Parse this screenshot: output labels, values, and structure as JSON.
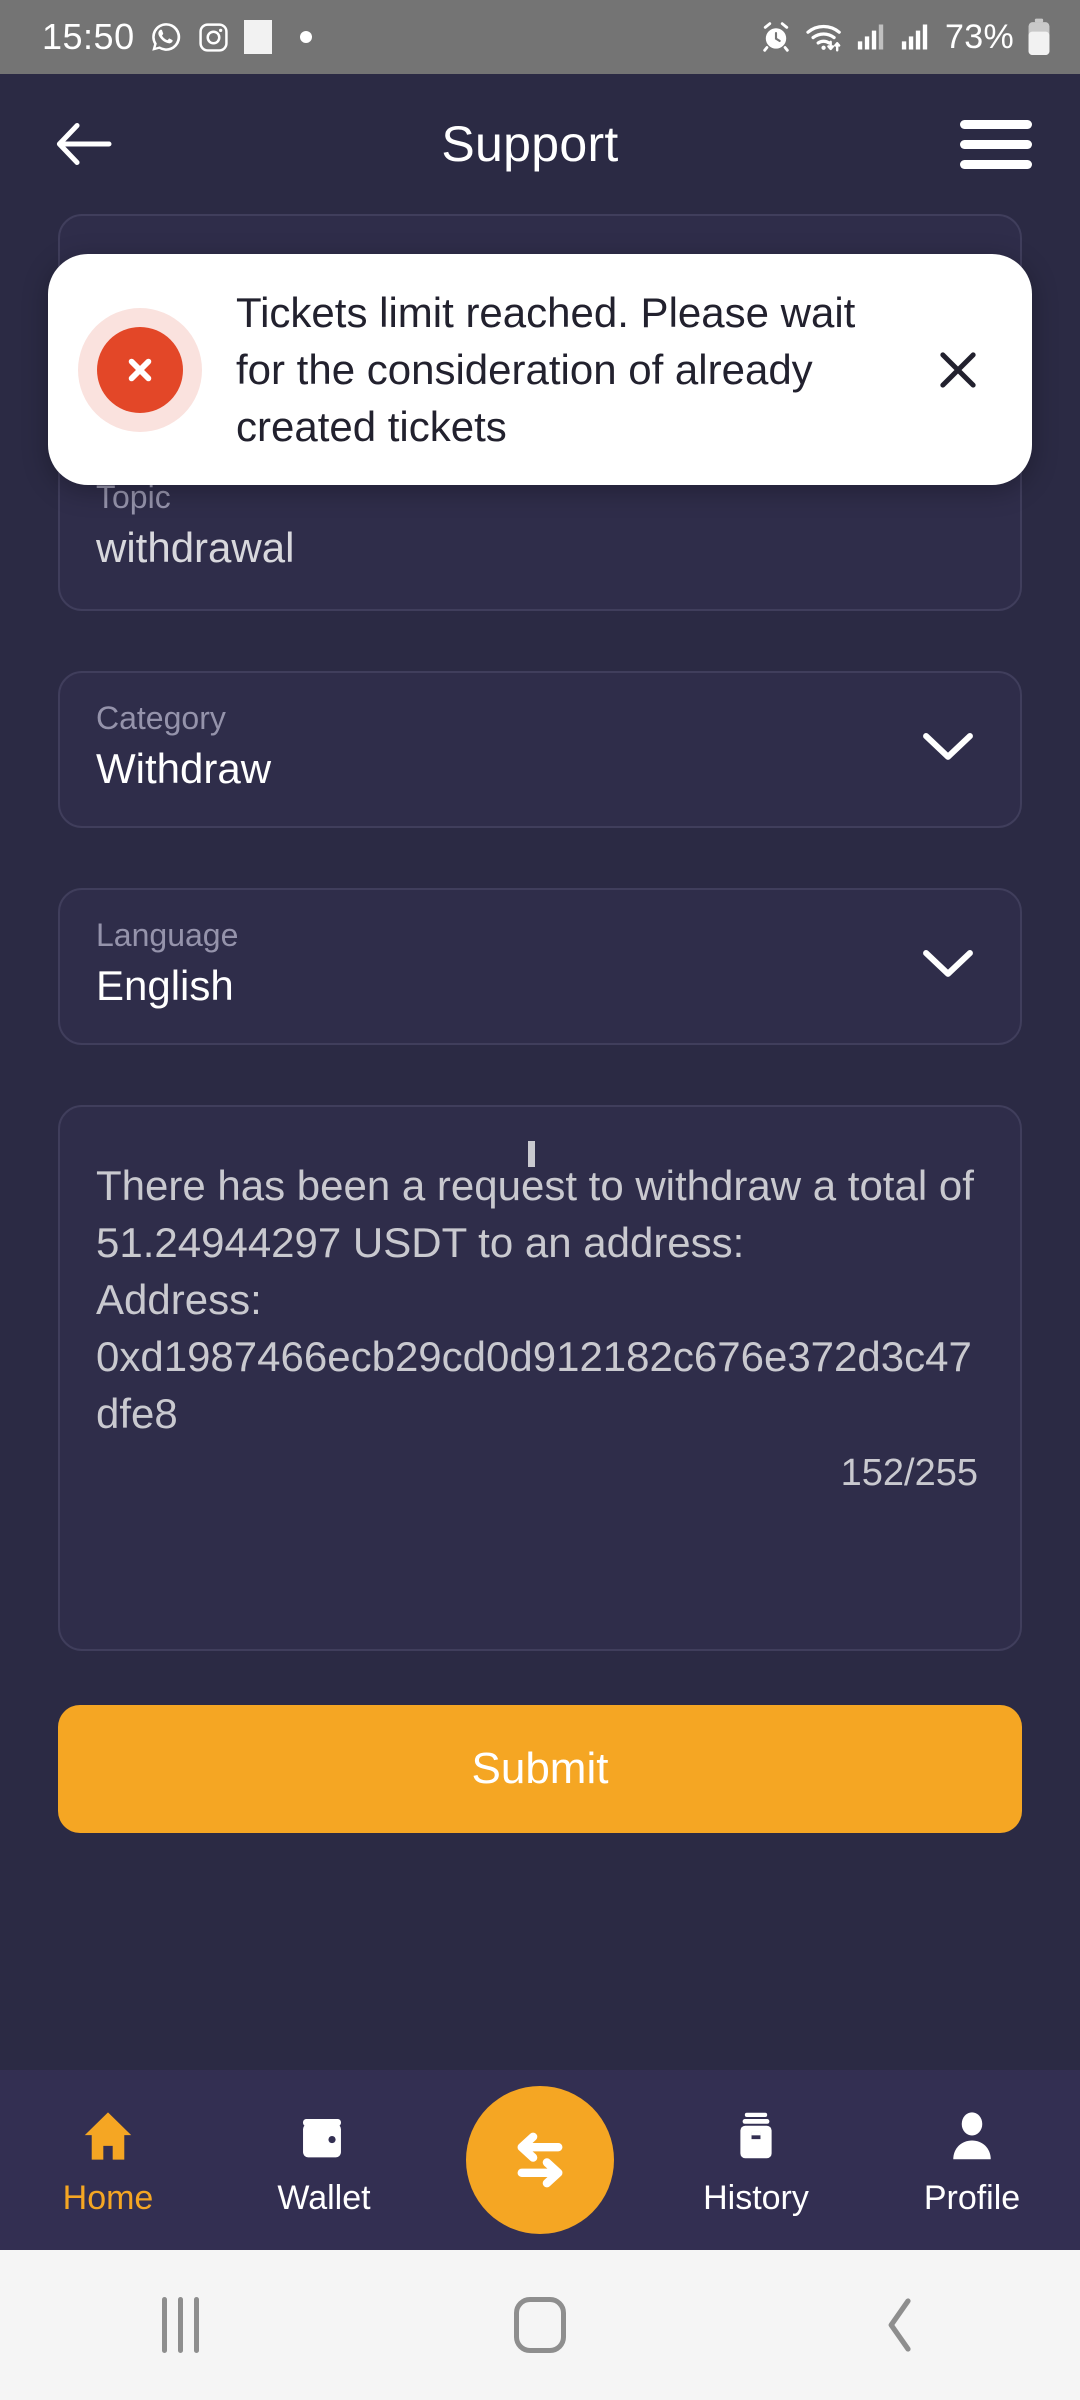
{
  "status_bar": {
    "time": "15:50",
    "icons_left": [
      "whatsapp-icon",
      "instagram-icon",
      "generic-app-icon",
      "dot-indicator-icon"
    ],
    "icons_right": [
      "alarm-icon",
      "wifi-icon",
      "signal-sim1-icon",
      "signal-sim2-icon"
    ],
    "battery_percent": "73%"
  },
  "header": {
    "back_label": "back-arrow",
    "title": "Support",
    "menu_label": "hamburger-menu"
  },
  "toast": {
    "message": "Tickets limit reached. Please wait for the consideration of already created tickets",
    "status_icon": "error-x-icon",
    "close_label": "close-icon",
    "accent_color": "#e34728",
    "halo_color": "#fae2de",
    "background": "#ffffff"
  },
  "form": {
    "topic": {
      "label": "Topic",
      "value": "withdrawal"
    },
    "category": {
      "label": "Category",
      "value": "Withdraw",
      "chevron": "chevron-down-icon"
    },
    "language": {
      "label": "Language",
      "value": "English",
      "chevron": "chevron-down-icon"
    },
    "message": {
      "text": "There has been a request to withdraw a total of 51.24944297 USDT to an address:\nAddress: 0xd1987466ecb29cd0d912182c676e372d3c47dfe8",
      "counter": "152/255",
      "max_length": "255",
      "current_length": "152"
    },
    "submit_label": "Submit",
    "submit_color": "#f5a623"
  },
  "bottom_nav": {
    "items": [
      {
        "label": "Home",
        "icon": "home-icon",
        "active": true
      },
      {
        "label": "Wallet",
        "icon": "wallet-icon",
        "active": false
      },
      {
        "label": "History",
        "icon": "history-icon",
        "active": false
      },
      {
        "label": "Profile",
        "icon": "profile-icon",
        "active": false
      }
    ],
    "fab": {
      "icon": "swap-arrows-icon",
      "color": "#f5a623"
    },
    "active_color": "#f5a623"
  },
  "system_nav": {
    "recents": "recents-icon",
    "home": "home-square-icon",
    "back": "back-chevron-icon"
  },
  "theme": {
    "page_background": "#2b2a44",
    "field_background": "#2f2d4a",
    "field_border": "#403e5c",
    "nav_background": "#332f52",
    "accent": "#f5a623"
  }
}
